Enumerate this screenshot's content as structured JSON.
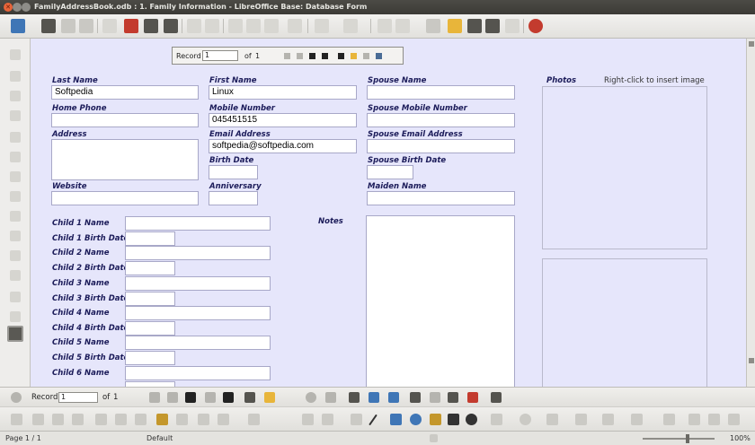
{
  "window": {
    "title": "FamilyAddressBook.odb : 1. Family Information - LibreOffice Base: Database Form"
  },
  "form_nav": {
    "record_label": "Record",
    "record_value": "1",
    "of_label": "of",
    "total": "1"
  },
  "labels": {
    "last_name": "Last Name",
    "first_name": "First Name",
    "spouse_name": "Spouse Name",
    "photos": "Photos",
    "photos_hint": "Right-click to insert image",
    "home_phone": "Home Phone",
    "mobile_number": "Mobile Number",
    "spouse_mobile_number": "Spouse Mobile Number",
    "address": "Address",
    "email_address": "Email Address",
    "spouse_email_address": "Spouse Email Address",
    "birth_date": "Birth Date",
    "spouse_birth_date": "Spouse Birth Date",
    "website": "Website",
    "anniversary": "Anniversary",
    "maiden_name": "Maiden Name",
    "notes": "Notes",
    "child1_name": "Child 1 Name",
    "child1_birth": "Child 1 Birth Date",
    "child2_name": "Child 2 Name",
    "child2_birth": "Child 2 Birth Date",
    "child3_name": "Child 3 Name",
    "child3_birth": "Child 3 Birth Date",
    "child4_name": "Child 4 Name",
    "child4_birth": "Child 4 Birth Date",
    "child5_name": "Child 5 Name",
    "child5_birth": "Child 5 Birth Date",
    "child6_name": "Child 6 Name"
  },
  "values": {
    "last_name": "Softpedia",
    "first_name": "Linux",
    "mobile_number": "045451515",
    "email_address": "softpedia@softpedia.com"
  },
  "bottom_nav": {
    "record_label": "Record",
    "record_value": "1",
    "of_label": "of",
    "total": "1"
  },
  "status": {
    "page": "Page 1 / 1",
    "style": "Default",
    "zoom": "100%"
  }
}
